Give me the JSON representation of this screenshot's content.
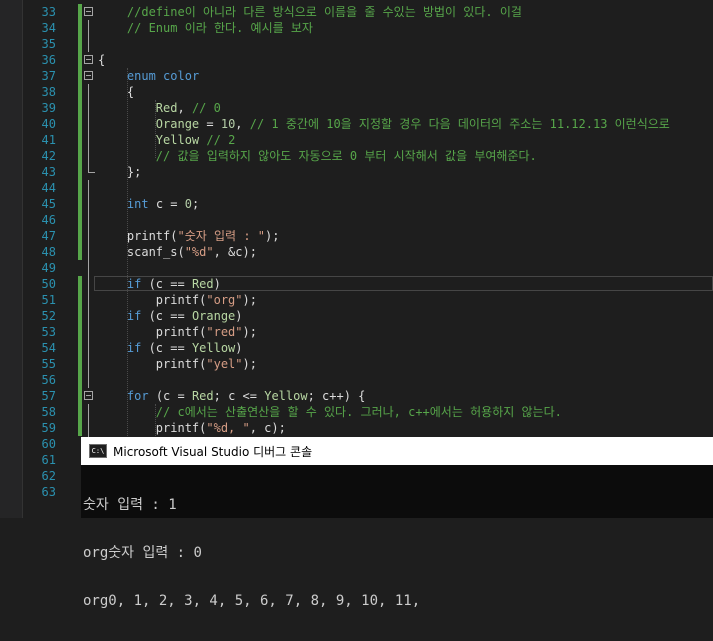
{
  "editor": {
    "lines": [
      {
        "n": "33",
        "tokens": [
          {
            "t": "//define이 아니라 다른 방식으로 이름을 줄 수있는 방법이 있다. 이걸",
            "c": "cm"
          }
        ]
      },
      {
        "n": "34",
        "tokens": [
          {
            "t": "// Enum 이라 한다. 예시를 보자",
            "c": "cm"
          }
        ]
      },
      {
        "n": "35",
        "tokens": []
      },
      {
        "n": "36",
        "tokens": [
          {
            "t": "{",
            "c": ""
          }
        ]
      },
      {
        "n": "37",
        "tokens": [
          {
            "t": "    ",
            "c": ""
          },
          {
            "t": "enum",
            "c": "kw"
          },
          {
            "t": " ",
            "c": ""
          },
          {
            "t": "color",
            "c": "kw"
          }
        ]
      },
      {
        "n": "38",
        "tokens": [
          {
            "t": "    {",
            "c": ""
          }
        ]
      },
      {
        "n": "39",
        "tokens": [
          {
            "t": "        ",
            "c": ""
          },
          {
            "t": "Red",
            "c": "en"
          },
          {
            "t": ", ",
            "c": ""
          },
          {
            "t": "// 0",
            "c": "cm"
          }
        ]
      },
      {
        "n": "40",
        "tokens": [
          {
            "t": "        ",
            "c": ""
          },
          {
            "t": "Orange",
            "c": "en"
          },
          {
            "t": " = ",
            "c": ""
          },
          {
            "t": "10",
            "c": "num"
          },
          {
            "t": ", ",
            "c": ""
          },
          {
            "t": "// 1 중간에 10을 지정할 경우 다음 데이터의 주소는 11.12.13 이런식으로",
            "c": "cm"
          }
        ]
      },
      {
        "n": "41",
        "tokens": [
          {
            "t": "        ",
            "c": ""
          },
          {
            "t": "Yellow",
            "c": "en"
          },
          {
            "t": " ",
            "c": ""
          },
          {
            "t": "// 2",
            "c": "cm"
          }
        ]
      },
      {
        "n": "42",
        "tokens": [
          {
            "t": "        ",
            "c": ""
          },
          {
            "t": "// 값을 입력하지 않아도 자동으로 0 부터 시작해서 값을 부여해준다.",
            "c": "cm"
          }
        ]
      },
      {
        "n": "43",
        "tokens": [
          {
            "t": "    };",
            "c": ""
          }
        ]
      },
      {
        "n": "44",
        "tokens": []
      },
      {
        "n": "45",
        "tokens": [
          {
            "t": "    ",
            "c": ""
          },
          {
            "t": "int",
            "c": "kw"
          },
          {
            "t": " c = ",
            "c": ""
          },
          {
            "t": "0",
            "c": "num"
          },
          {
            "t": ";",
            "c": ""
          }
        ]
      },
      {
        "n": "46",
        "tokens": []
      },
      {
        "n": "47",
        "tokens": [
          {
            "t": "    printf(",
            "c": ""
          },
          {
            "t": "\"숫자 입력 : \"",
            "c": "str"
          },
          {
            "t": ");",
            "c": ""
          }
        ]
      },
      {
        "n": "48",
        "tokens": [
          {
            "t": "    scanf_s(",
            "c": ""
          },
          {
            "t": "\"%d\"",
            "c": "str"
          },
          {
            "t": ", &c);",
            "c": ""
          }
        ]
      },
      {
        "n": "49",
        "tokens": []
      },
      {
        "n": "50",
        "tokens": [
          {
            "t": "    ",
            "c": ""
          },
          {
            "t": "if",
            "c": "kw"
          },
          {
            "t": " (c == ",
            "c": ""
          },
          {
            "t": "Red",
            "c": "en"
          },
          {
            "t": ")",
            "c": ""
          }
        ]
      },
      {
        "n": "51",
        "tokens": [
          {
            "t": "        printf(",
            "c": ""
          },
          {
            "t": "\"org\"",
            "c": "str"
          },
          {
            "t": ");",
            "c": ""
          }
        ]
      },
      {
        "n": "52",
        "tokens": [
          {
            "t": "    ",
            "c": ""
          },
          {
            "t": "if",
            "c": "kw"
          },
          {
            "t": " (c == ",
            "c": ""
          },
          {
            "t": "Orange",
            "c": "en"
          },
          {
            "t": ")",
            "c": ""
          }
        ]
      },
      {
        "n": "53",
        "tokens": [
          {
            "t": "        printf(",
            "c": ""
          },
          {
            "t": "\"red\"",
            "c": "str"
          },
          {
            "t": ");",
            "c": ""
          }
        ]
      },
      {
        "n": "54",
        "tokens": [
          {
            "t": "    ",
            "c": ""
          },
          {
            "t": "if",
            "c": "kw"
          },
          {
            "t": " (c == ",
            "c": ""
          },
          {
            "t": "Yellow",
            "c": "en"
          },
          {
            "t": ")",
            "c": ""
          }
        ]
      },
      {
        "n": "55",
        "tokens": [
          {
            "t": "        printf(",
            "c": ""
          },
          {
            "t": "\"yel\"",
            "c": "str"
          },
          {
            "t": ");",
            "c": ""
          }
        ]
      },
      {
        "n": "56",
        "tokens": []
      },
      {
        "n": "57",
        "tokens": [
          {
            "t": "    ",
            "c": ""
          },
          {
            "t": "for",
            "c": "kw"
          },
          {
            "t": " (c = ",
            "c": ""
          },
          {
            "t": "Red",
            "c": "en"
          },
          {
            "t": "; c <= ",
            "c": ""
          },
          {
            "t": "Yellow",
            "c": "en"
          },
          {
            "t": "; c++) {",
            "c": ""
          }
        ]
      },
      {
        "n": "58",
        "tokens": [
          {
            "t": "        ",
            "c": ""
          },
          {
            "t": "// c에서는 산출연산을 할 수 있다. 그러나, c++에서는 허용하지 않는다.",
            "c": "cm"
          }
        ]
      },
      {
        "n": "59",
        "tokens": [
          {
            "t": "        printf(",
            "c": ""
          },
          {
            "t": "\"%d, \"",
            "c": "str"
          },
          {
            "t": ", c);",
            "c": ""
          }
        ]
      },
      {
        "n": "60",
        "tokens": []
      },
      {
        "n": "61",
        "tokens": []
      },
      {
        "n": "62",
        "tokens": []
      },
      {
        "n": "63",
        "tokens": []
      }
    ]
  },
  "console": {
    "icon_text": "C:\\",
    "title": "Microsoft Visual Studio 디버그 콘솔",
    "output": [
      "숫자 입력 : 1",
      "org숫자 입력 : 0",
      "org0, 1, 2, 3, 4, 5, 6, 7, 8, 9, 10, 11,"
    ]
  }
}
